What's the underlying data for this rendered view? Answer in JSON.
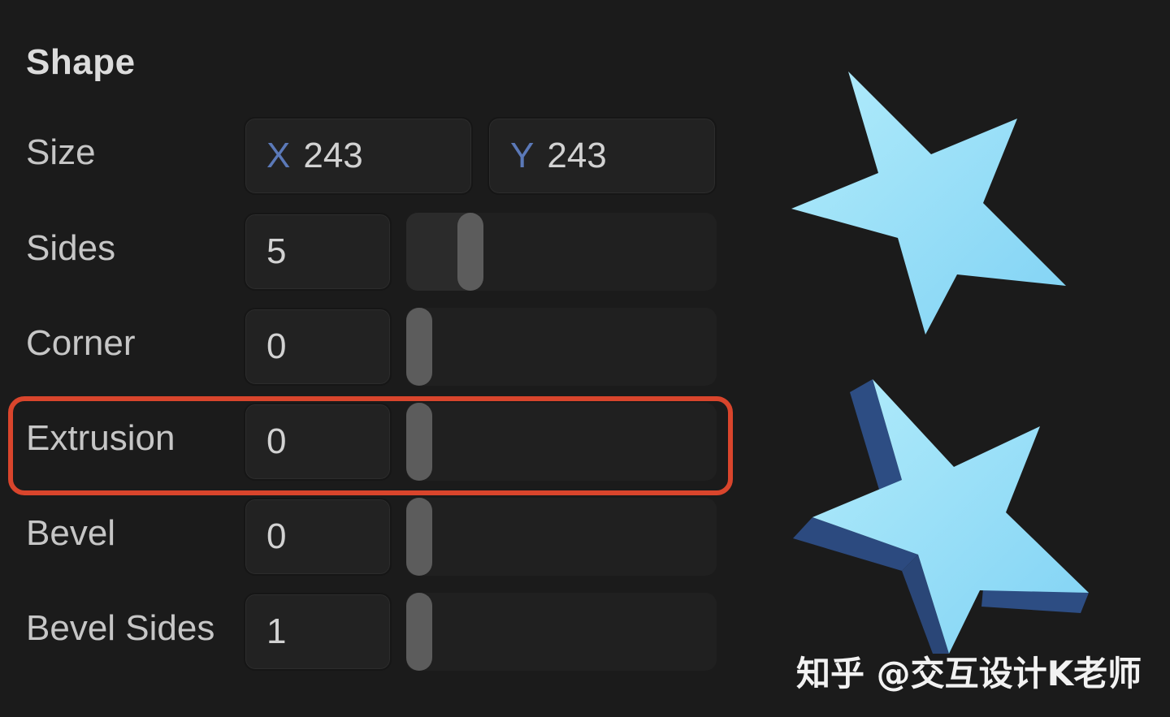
{
  "panel": {
    "title": "Shape",
    "size": {
      "label": "Size",
      "x_axis": "X",
      "x_value": "243",
      "y_axis": "Y",
      "y_value": "243"
    },
    "sliders": [
      {
        "label": "Sides",
        "value": "5",
        "level": 0.18
      },
      {
        "label": "Corner",
        "value": "0",
        "level": 0.0
      },
      {
        "label": "Extrusion",
        "value": "0",
        "level": 0.0
      },
      {
        "label": "Bevel",
        "value": "0",
        "level": 0.0
      },
      {
        "label": "Bevel Sides",
        "value": "1",
        "level": 0.0
      }
    ],
    "highlighted_row": "Extrusion",
    "highlight_color": "#d9452c"
  },
  "preview": {
    "flat_star_icon": "star-flat-icon",
    "extruded_star_icon": "star-extruded-icon",
    "star_face_color": "#8fdcf6",
    "star_side_color": "#2f4f86"
  },
  "watermark": {
    "text": "知乎 @交互设计K老师"
  }
}
